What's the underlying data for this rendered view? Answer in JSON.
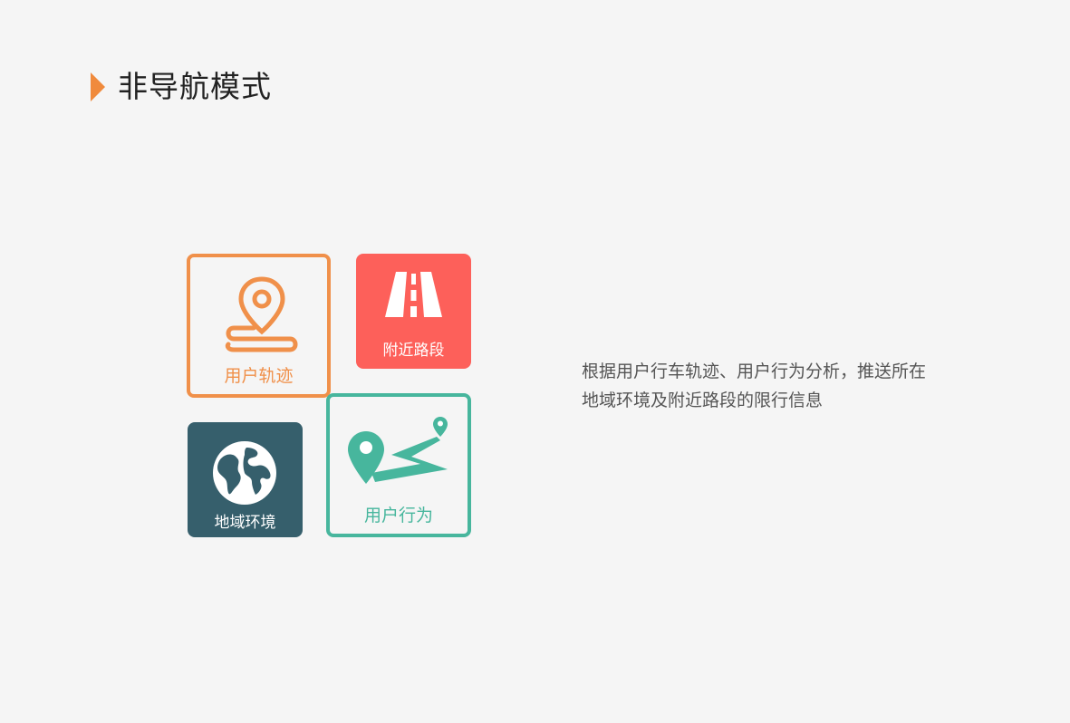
{
  "heading": {
    "title": "非导航模式"
  },
  "tiles": [
    {
      "label": "用户轨迹",
      "icon": "location-track-icon",
      "color": "#f0904a"
    },
    {
      "label": "附近路段",
      "icon": "road-icon",
      "color": "#fd605a"
    },
    {
      "label": "地域环境",
      "icon": "globe-icon",
      "color": "#365f6c"
    },
    {
      "label": "用户行为",
      "icon": "route-map-icon",
      "color": "#47b69d"
    }
  ],
  "description": {
    "line1": "根据用户行车轨迹、用户行为分析，推送所在",
    "line2": "地域环境及附近路段的限行信息"
  },
  "colors": {
    "accent": "#f08a3c",
    "background": "#f5f5f5"
  }
}
